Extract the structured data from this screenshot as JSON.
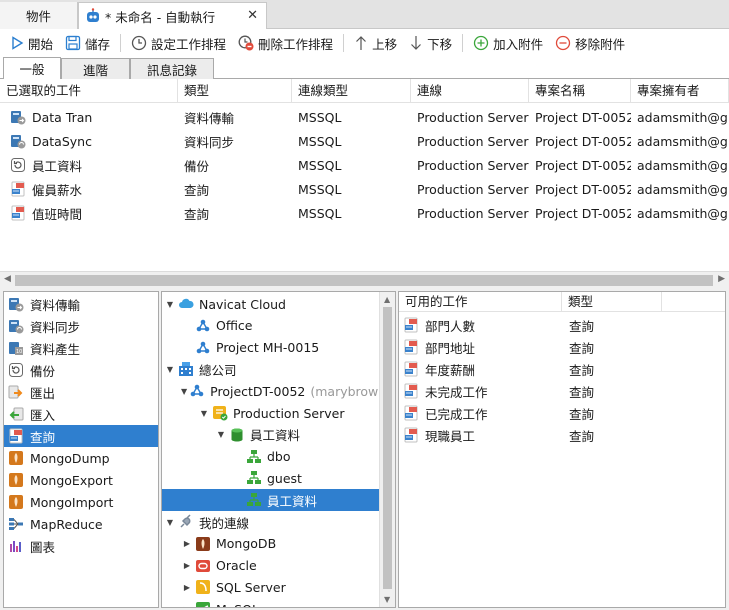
{
  "window_tabs": [
    {
      "label": "物件"
    },
    {
      "label": "* 未命名 - 自動執行",
      "close": "✕"
    }
  ],
  "toolbar": {
    "start": "開始",
    "save": "儲存",
    "set_schedule": "設定工作排程",
    "delete_schedule": "刪除工作排程",
    "move_up": "上移",
    "move_down": "下移",
    "add_attachment": "加入附件",
    "remove_attachment": "移除附件"
  },
  "sub_tabs": [
    "一般",
    "進階",
    "訊息記錄"
  ],
  "jobs": {
    "headers": [
      "已選取的工件",
      "類型",
      "連線類型",
      "連線",
      "專案名稱",
      "專案擁有者"
    ],
    "rows": [
      {
        "name": "Data Tran",
        "type": "資料傳輸",
        "conn_type": "MSSQL",
        "conn": "Production Server",
        "project": "Project DT-0052",
        "owner": "adamsmith@gmail.com",
        "icon": "transfer-icon"
      },
      {
        "name": "DataSync",
        "type": "資料同步",
        "conn_type": "MSSQL",
        "conn": "Production Server",
        "project": "Project DT-0052",
        "owner": "adamsmith@gmail.com",
        "icon": "sync-icon"
      },
      {
        "name": "員工資料",
        "type": "備份",
        "conn_type": "MSSQL",
        "conn": "Production Server",
        "project": "Project DT-0052",
        "owner": "adamsmith@gmail.com",
        "icon": "backup-icon"
      },
      {
        "name": "僱員薪水",
        "type": "查詢",
        "conn_type": "MSSQL",
        "conn": "Production Server",
        "project": "Project DT-0052",
        "owner": "adamsmith@gmail.com",
        "icon": "query-icon"
      },
      {
        "name": "值班時間",
        "type": "查詢",
        "conn_type": "MSSQL",
        "conn": "Production Server",
        "project": "Project DT-0052",
        "owner": "adamsmith@gmail.com",
        "icon": "query-icon"
      }
    ]
  },
  "job_types": [
    {
      "label": "資料傳輸",
      "icon": "transfer-icon"
    },
    {
      "label": "資料同步",
      "icon": "sync-icon"
    },
    {
      "label": "資料產生",
      "icon": "data-generate-icon"
    },
    {
      "label": "備份",
      "icon": "backup-icon"
    },
    {
      "label": "匯出",
      "icon": "export-icon"
    },
    {
      "label": "匯入",
      "icon": "import-icon"
    },
    {
      "label": "查詢",
      "icon": "query-icon",
      "selected": true
    },
    {
      "label": "MongoDump",
      "icon": "mongo-dump-icon"
    },
    {
      "label": "MongoExport",
      "icon": "mongo-export-icon"
    },
    {
      "label": "MongoImport",
      "icon": "mongo-import-icon"
    },
    {
      "label": "MapReduce",
      "icon": "map-reduce-icon"
    },
    {
      "label": "圖表",
      "icon": "chart-icon"
    }
  ],
  "tree": [
    {
      "label": "Navicat Cloud",
      "level": 0,
      "twisty": "down",
      "icon": "cloud-icon"
    },
    {
      "label": "Office",
      "level": 1,
      "twisty": "none",
      "icon": "project-icon"
    },
    {
      "label": "Project MH-0015",
      "level": 1,
      "twisty": "none",
      "icon": "project-icon"
    },
    {
      "label": "總公司",
      "level": 0,
      "twisty": "down",
      "icon": "company-icon"
    },
    {
      "label": "ProjectDT-0052",
      "sub": "(marybrown",
      "level": 1,
      "twisty": "down",
      "icon": "project-icon"
    },
    {
      "label": "Production Server",
      "level": 2,
      "twisty": "down",
      "icon": "server-icon"
    },
    {
      "label": "員工資料",
      "level": 3,
      "twisty": "down",
      "icon": "database-icon"
    },
    {
      "label": "dbo",
      "level": 4,
      "twisty": "none",
      "icon": "schema-icon"
    },
    {
      "label": "guest",
      "level": 4,
      "twisty": "none",
      "icon": "schema-icon"
    },
    {
      "label": "員工資料",
      "level": 4,
      "twisty": "none",
      "icon": "schema-icon",
      "selected": true
    },
    {
      "label": "我的連線",
      "level": 0,
      "twisty": "down",
      "icon": "plug-icon"
    },
    {
      "label": "MongoDB",
      "level": 1,
      "twisty": "right",
      "icon": "mongodb-icon"
    },
    {
      "label": "Oracle",
      "level": 1,
      "twisty": "right",
      "icon": "oracle-icon"
    },
    {
      "label": "SQL Server",
      "level": 1,
      "twisty": "right",
      "icon": "sqlserver-icon"
    },
    {
      "label": "MySQL",
      "level": 1,
      "twisty": "right",
      "icon": "mysql-icon"
    }
  ],
  "available": {
    "headers": [
      "可用的工作",
      "類型"
    ],
    "rows": [
      {
        "name": "部門人數",
        "type": "查詢"
      },
      {
        "name": "部門地址",
        "type": "查詢"
      },
      {
        "name": "年度薪酬",
        "type": "查詢"
      },
      {
        "name": "未完成工作",
        "type": "查詢"
      },
      {
        "name": "已完成工作",
        "type": "查詢"
      },
      {
        "name": "現職員工",
        "type": "查詢"
      }
    ]
  },
  "colors": {
    "selection": "#2f7fcf",
    "accent_blue": "#2b7fd0",
    "red": "#e04a3a",
    "green": "#3aa63a"
  }
}
